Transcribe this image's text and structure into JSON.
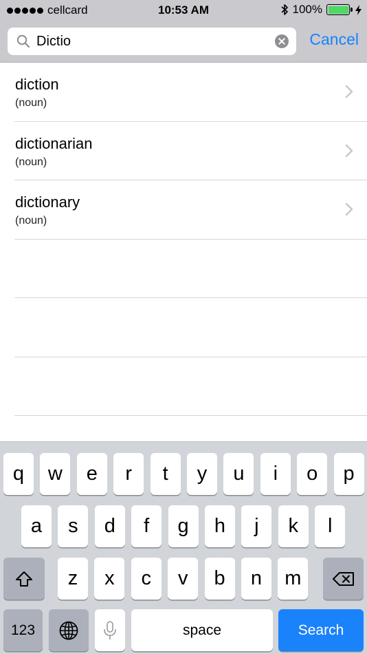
{
  "status_bar": {
    "carrier": "cellcard",
    "time": "10:53 AM",
    "battery_percent_label": "100%",
    "battery_level": 1.0,
    "signal_bars": 5,
    "icons": [
      "bluetooth-icon",
      "battery-icon",
      "charging-bolt-icon"
    ]
  },
  "search": {
    "query": "Dictio",
    "cancel_label": "Cancel",
    "icons": [
      "search-icon",
      "clear-icon"
    ]
  },
  "results": [
    {
      "word": "diction",
      "part_of_speech": "(noun)"
    },
    {
      "word": "dictionarian",
      "part_of_speech": "(noun)"
    },
    {
      "word": "dictionary",
      "part_of_speech": "(noun)"
    }
  ],
  "keyboard": {
    "row1": [
      "q",
      "w",
      "e",
      "r",
      "t",
      "y",
      "u",
      "i",
      "o",
      "p"
    ],
    "row2": [
      "a",
      "s",
      "d",
      "f",
      "g",
      "h",
      "j",
      "k",
      "l"
    ],
    "row3": [
      "z",
      "x",
      "c",
      "v",
      "b",
      "n",
      "m"
    ],
    "numbers_label": "123",
    "space_label": "space",
    "search_label": "Search",
    "icons": [
      "shift-icon",
      "delete-icon",
      "globe-icon",
      "microphone-icon"
    ]
  },
  "colors": {
    "accent": "#1a82fb",
    "bar_background": "#c9c9ce",
    "keyboard_background": "#d1d4d9",
    "battery": "#4cd964"
  }
}
